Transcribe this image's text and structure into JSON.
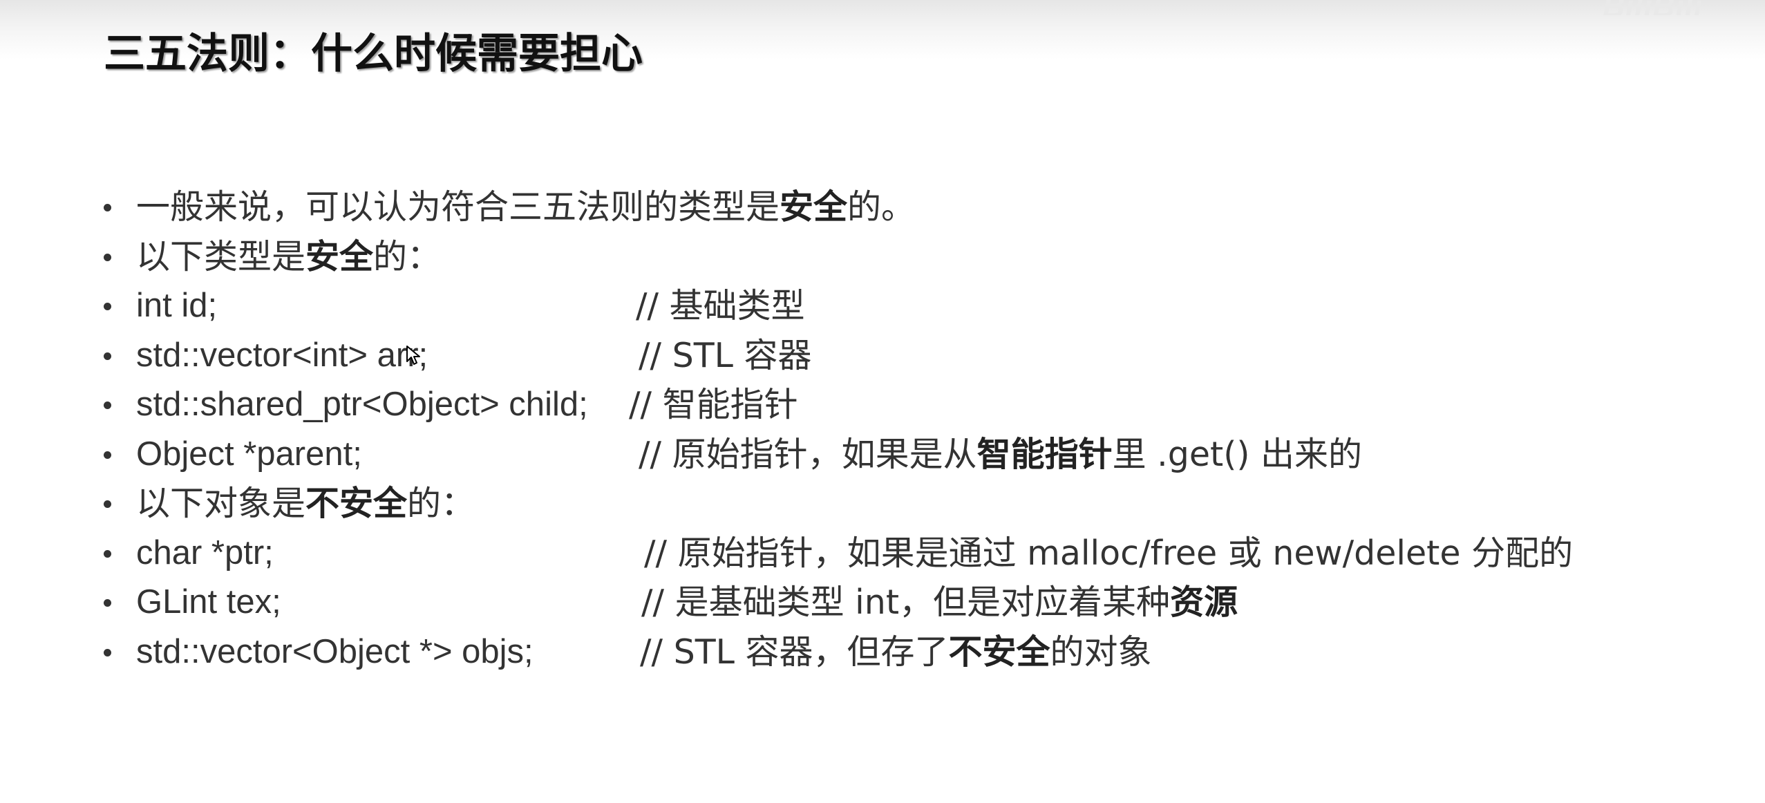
{
  "slide": {
    "title": "三五法则：什么时候需要担心",
    "watermark": "BiliBili"
  },
  "bullets": [
    {
      "parts": [
        "一般来说，可以认为符合三五法则的类型是",
        "安全",
        "的。"
      ]
    },
    {
      "parts": [
        "以下类型是",
        "安全",
        "的："
      ]
    },
    {
      "code": "int id;",
      "comment_parts": [
        "// 基础类型"
      ]
    },
    {
      "code": "std::vector<int> arr;",
      "comment_parts": [
        "// STL 容器"
      ]
    },
    {
      "code": "std::shared_ptr<Object> child;",
      "comment_parts": [
        "// 智能指针"
      ]
    },
    {
      "code": "Object *parent;",
      "comment_parts": [
        "// 原始指针，如果是从",
        "智能指针",
        "里 .get() 出来的"
      ]
    },
    {
      "parts": [
        "以下对象是",
        "不安全",
        "的："
      ]
    },
    {
      "code": "char *ptr;",
      "comment_parts": [
        "// 原始指针，如果是通过 malloc/free 或 new/delete 分配的"
      ]
    },
    {
      "code": "GLint tex;",
      "comment_parts": [
        "// 是基础类型 int，但是对应着某种",
        "资源"
      ]
    },
    {
      "code": "std::vector<Object *> objs;",
      "comment_parts": [
        "// STL 容器，但存了",
        "不安全",
        "的对象"
      ]
    }
  ]
}
